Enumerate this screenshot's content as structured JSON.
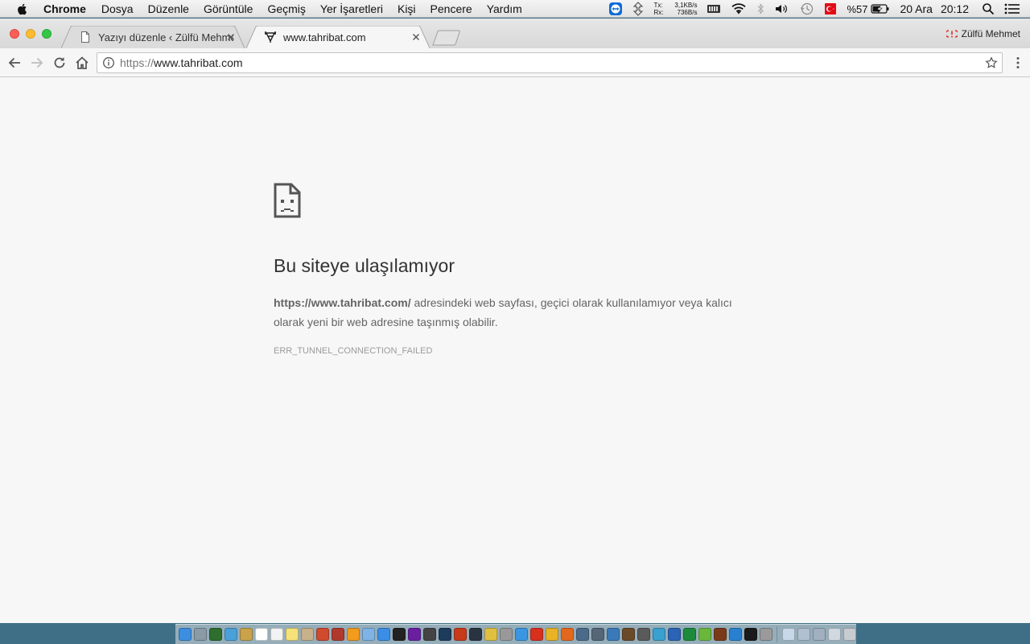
{
  "menubar": {
    "app_name": "Chrome",
    "items": [
      "Dosya",
      "Düzenle",
      "Görüntüle",
      "Geçmiş",
      "Yer İşaretleri",
      "Kişi",
      "Pencere",
      "Yardım"
    ],
    "netmeter": {
      "tx_label": "Tx:",
      "tx_value": "3,1KB/s",
      "rx_label": "Rx:",
      "rx_value": "736B/s"
    },
    "battery_percent": "%57",
    "date": "20 Ara",
    "time": "20:12"
  },
  "browser": {
    "tabs": [
      {
        "title": "Yazıyı düzenle ‹ Zülfü Mehmet",
        "icon": "document-icon",
        "active": false
      },
      {
        "title": "www.tahribat.com",
        "icon": "tahribat-favicon",
        "active": true
      }
    ],
    "profile_name": "Zülfü Mehmet",
    "omnibox": {
      "scheme": "https://",
      "host": "www.tahribat.com",
      "full": "https://www.tahribat.com"
    }
  },
  "error_page": {
    "title": "Bu siteye ulaşılamıyor",
    "url_bold": "https://www.tahribat.com/",
    "description": " adresindeki web sayfası, geçici olarak kullanılamıyor veya kalıcı olarak yeni bir web adresine taşınmış olabilir.",
    "error_code": "ERR_TUNNEL_CONNECTION_FAILED"
  },
  "colors": {
    "menubar_bg": "#ececec",
    "page_bg": "#f7f7f7",
    "title_text": "#333333",
    "body_text": "#646464",
    "code_text": "#9b9b9b",
    "desktop": "#3f6f86"
  },
  "dock": {
    "apps": [
      {
        "name": "finder",
        "color": "#3c8fe0"
      },
      {
        "name": "launchpad",
        "color": "#8a9aa6"
      },
      {
        "name": "app-3",
        "color": "#2f6e2f"
      },
      {
        "name": "app-4",
        "color": "#4aa0d8"
      },
      {
        "name": "app-5",
        "color": "#c9a24a"
      },
      {
        "name": "calendar",
        "color": "#ffffff"
      },
      {
        "name": "app-7",
        "color": "#f2f2f2"
      },
      {
        "name": "notes",
        "color": "#f6e27a"
      },
      {
        "name": "app-9",
        "color": "#c7b08a"
      },
      {
        "name": "app-10",
        "color": "#d04a2e"
      },
      {
        "name": "app-11",
        "color": "#b0392e"
      },
      {
        "name": "app-12",
        "color": "#f39b1c"
      },
      {
        "name": "itunes",
        "color": "#7fb3e6"
      },
      {
        "name": "app-store",
        "color": "#3a8ee6"
      },
      {
        "name": "app-15",
        "color": "#222222"
      },
      {
        "name": "app-16",
        "color": "#6a1fa0"
      },
      {
        "name": "app-17",
        "color": "#444444"
      },
      {
        "name": "photoshop",
        "color": "#1d3b5a"
      },
      {
        "name": "app-19",
        "color": "#c73a1a"
      },
      {
        "name": "lightroom",
        "color": "#2a3340"
      },
      {
        "name": "app-21",
        "color": "#e0c040"
      },
      {
        "name": "app-22",
        "color": "#999999"
      },
      {
        "name": "safari",
        "color": "#3a96e0"
      },
      {
        "name": "app-24",
        "color": "#d8301c"
      },
      {
        "name": "chrome",
        "color": "#e8b325"
      },
      {
        "name": "firefox",
        "color": "#e3681d"
      },
      {
        "name": "app-27",
        "color": "#4c6b8a"
      },
      {
        "name": "app-28",
        "color": "#556677"
      },
      {
        "name": "app-29",
        "color": "#3a7ab8"
      },
      {
        "name": "app-30",
        "color": "#6b4a2a"
      },
      {
        "name": "app-31",
        "color": "#5a5a5a"
      },
      {
        "name": "app-32",
        "color": "#3aa0d0"
      },
      {
        "name": "word",
        "color": "#2b63b6"
      },
      {
        "name": "excel",
        "color": "#1e8a3c"
      },
      {
        "name": "utorrent",
        "color": "#6ab73c"
      },
      {
        "name": "app-36",
        "color": "#7a3a1a"
      },
      {
        "name": "app-37",
        "color": "#2a80d0"
      },
      {
        "name": "terminal",
        "color": "#1a1a1a"
      },
      {
        "name": "app-39",
        "color": "#9a9a9a"
      },
      {
        "name": "preview",
        "color": "#c8d8e8"
      },
      {
        "name": "app-41",
        "color": "#b0c0d0"
      },
      {
        "name": "app-42",
        "color": "#a0b0c0"
      },
      {
        "name": "app-43",
        "color": "#d0d8e0"
      },
      {
        "name": "trash",
        "color": "#c8ccd0"
      }
    ]
  }
}
